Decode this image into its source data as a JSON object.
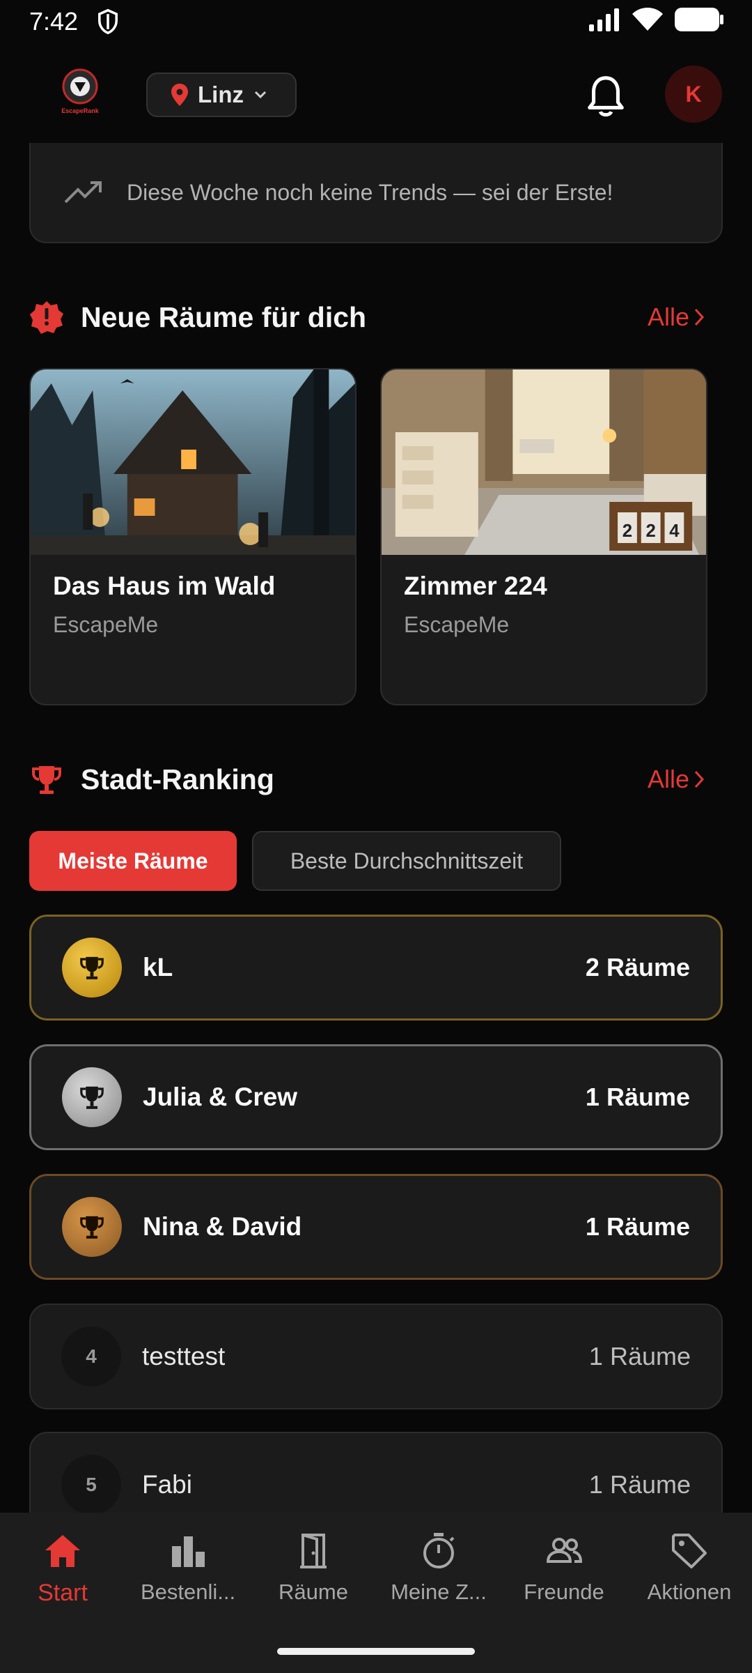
{
  "status_bar": {
    "time": "7:42"
  },
  "header": {
    "city": "Linz",
    "avatar_initial": "K",
    "logo_text": "EscapeRank"
  },
  "trends": {
    "text": "Diese Woche noch keine Trends — sei der Erste!"
  },
  "new_rooms": {
    "title": "Neue Räume für dich",
    "all_label": "Alle",
    "rooms": [
      {
        "title": "Das Haus im Wald",
        "provider": "EscapeMe"
      },
      {
        "title": "Zimmer 224",
        "provider": "EscapeMe",
        "door_number": "224"
      }
    ]
  },
  "city_ranking": {
    "title": "Stadt-Ranking",
    "all_label": "Alle",
    "filters": [
      {
        "label": "Meiste Räume",
        "active": true
      },
      {
        "label": "Beste Durchschnittszeit",
        "active": false
      }
    ],
    "entries": [
      {
        "rank": "1",
        "name": "kL",
        "value": "2 Räume",
        "medal": "gold"
      },
      {
        "rank": "2",
        "name": "Julia & Crew",
        "value": "1 Räume",
        "medal": "silver"
      },
      {
        "rank": "3",
        "name": "Nina & David",
        "value": "1 Räume",
        "medal": "bronze"
      },
      {
        "rank": "4",
        "name": "testtest",
        "value": "1 Räume",
        "medal": "none"
      },
      {
        "rank": "5",
        "name": "Fabi",
        "value": "1 Räume",
        "medal": "none"
      }
    ]
  },
  "bottom_nav": [
    {
      "label": "Start",
      "icon": "home-icon",
      "active": true
    },
    {
      "label": "Bestenli...",
      "icon": "bar-chart-icon",
      "active": false
    },
    {
      "label": "Räume",
      "icon": "door-icon",
      "active": false
    },
    {
      "label": "Meine Z...",
      "icon": "timer-icon",
      "active": false
    },
    {
      "label": "Freunde",
      "icon": "friends-icon",
      "active": false
    },
    {
      "label": "Aktionen",
      "icon": "tag-icon",
      "active": false
    }
  ],
  "colors": {
    "accent": "#e53935",
    "background": "#080808",
    "card": "#1b1b1b",
    "gold": "#d4a017",
    "silver": "#b0b0b0",
    "bronze": "#b87333"
  }
}
